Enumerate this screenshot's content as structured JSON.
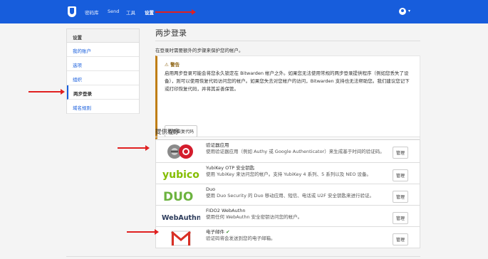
{
  "topbar": {
    "nav": [
      "密码库",
      "Send",
      "工具",
      "设置"
    ],
    "active_index": 3,
    "caret": "▾",
    "colors": {
      "bar": "#175ddc"
    }
  },
  "sidebar": {
    "header": "设置",
    "items": [
      {
        "label": "我的账户",
        "active": false
      },
      {
        "label": "选项",
        "active": false
      },
      {
        "label": "组织",
        "active": false
      },
      {
        "label": "两步登录",
        "active": true
      },
      {
        "label": "域名规则",
        "active": false
      }
    ]
  },
  "main": {
    "title": "两步登录",
    "description": "在登录时需要额外的步骤来保护您的帐户。",
    "warning": {
      "icon": "warning-icon",
      "title": "警告",
      "body": "启用两步登录可能会将您永久锁定在 Bitwarden 帐户之外。如果您无法使用常规的两步登录提供程序（例如您丢失了设备），则可以使用恢复代码访问您的帐户。如果您失去对您帐户的访问，Bitwarden 支持也无法帮助您。我们建议您记下或打印恢复代码，并将其妥善保管。",
      "button": "查看恢复代码",
      "color": "#bf7e16"
    },
    "providers_title": "提供程序",
    "providers": [
      {
        "logo": "authenticator-logo",
        "name": "验证器应用",
        "desc": "使用验证器应用（例如 Authy 或 Google Authenticator）来生成基于时间的验证码。",
        "button": "管理",
        "enabled": false
      },
      {
        "logo": "yubico-logo",
        "logo_text": "yubico",
        "name": "YubiKey OTP 安全钥匙",
        "desc": "使用 YubiKey 来访问您的帐户。支持 YubiKey 4 系列、5 系列以及 NEO 设备。",
        "button": "管理",
        "enabled": false
      },
      {
        "logo": "duo-logo",
        "logo_text": "DUO",
        "name": "Duo",
        "desc": "使用 Duo Security 的 Duo 移动应用、短信、电话或 U2F 安全钥匙来进行验证。",
        "button": "管理",
        "enabled": false
      },
      {
        "logo": "webauthn-logo",
        "logo_text": "WebAuthn",
        "name": "FIDO2 WebAuthn",
        "desc": "使用任何 WebAuthn 安全密钥访问您的帐户。",
        "button": "管理",
        "enabled": false
      },
      {
        "logo": "gmail-logo",
        "name": "电子邮件",
        "check": "✔",
        "desc": "验证码将会发送到您的电子邮箱。",
        "button": "管理",
        "enabled": true
      }
    ]
  },
  "annotations": {
    "arrow_color": "#e02020"
  }
}
